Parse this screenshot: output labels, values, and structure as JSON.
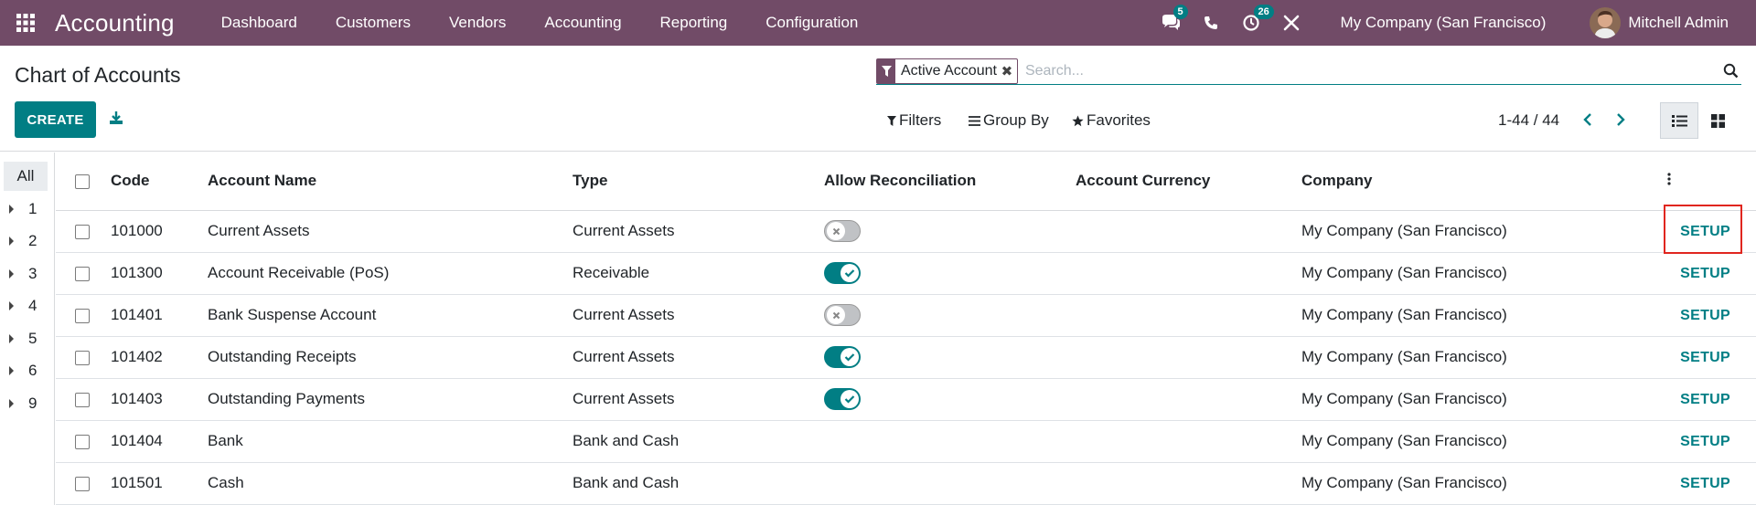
{
  "navbar": {
    "app_name": "Accounting",
    "menu": [
      "Dashboard",
      "Customers",
      "Vendors",
      "Accounting",
      "Reporting",
      "Configuration"
    ],
    "messages_count": "5",
    "activities_count": "26",
    "company": "My Company (San Francisco)",
    "user": "Mitchell Admin",
    "bg_color": "#714B67"
  },
  "control_panel": {
    "title": "Chart of Accounts",
    "create_label": "CREATE",
    "facet_label": "Active Account",
    "search_placeholder": "Search...",
    "filters_label": "Filters",
    "group_by_label": "Group By",
    "favorites_label": "Favorites",
    "pager_text": "1-44 / 44"
  },
  "side_panel": {
    "all_label": "All",
    "groups": [
      "1",
      "2",
      "3",
      "4",
      "5",
      "6",
      "9"
    ]
  },
  "table": {
    "headers": {
      "code": "Code",
      "name": "Account Name",
      "type": "Type",
      "reconcile": "Allow Reconciliation",
      "currency": "Account Currency",
      "company": "Company"
    },
    "rows": [
      {
        "code": "101000",
        "name": "Current Assets",
        "type": "Current Assets",
        "reconcile": "off",
        "currency": "",
        "company": "My Company (San Francisco)",
        "action": "SETUP"
      },
      {
        "code": "101300",
        "name": "Account Receivable (PoS)",
        "type": "Receivable",
        "reconcile": "on",
        "currency": "",
        "company": "My Company (San Francisco)",
        "action": "SETUP"
      },
      {
        "code": "101401",
        "name": "Bank Suspense Account",
        "type": "Current Assets",
        "reconcile": "off",
        "currency": "",
        "company": "My Company (San Francisco)",
        "action": "SETUP"
      },
      {
        "code": "101402",
        "name": "Outstanding Receipts",
        "type": "Current Assets",
        "reconcile": "on",
        "currency": "",
        "company": "My Company (San Francisco)",
        "action": "SETUP"
      },
      {
        "code": "101403",
        "name": "Outstanding Payments",
        "type": "Current Assets",
        "reconcile": "on",
        "currency": "",
        "company": "My Company (San Francisco)",
        "action": "SETUP"
      },
      {
        "code": "101404",
        "name": "Bank",
        "type": "Bank and Cash",
        "reconcile": "none",
        "currency": "",
        "company": "My Company (San Francisco)",
        "action": "SETUP"
      },
      {
        "code": "101501",
        "name": "Cash",
        "type": "Bank and Cash",
        "reconcile": "none",
        "currency": "",
        "company": "My Company (San Francisco)",
        "action": "SETUP"
      }
    ]
  },
  "colors": {
    "accent": "#017E84",
    "highlight": "#e0261f"
  },
  "icons": [
    "apps-grid-icon",
    "messages-icon",
    "phone-icon",
    "activity-clock-icon",
    "tools-icon",
    "download-icon",
    "filter-icon",
    "search-icon",
    "chevron-left-icon",
    "chevron-right-icon",
    "list-view-icon",
    "kanban-view-icon",
    "column-options-icon"
  ]
}
